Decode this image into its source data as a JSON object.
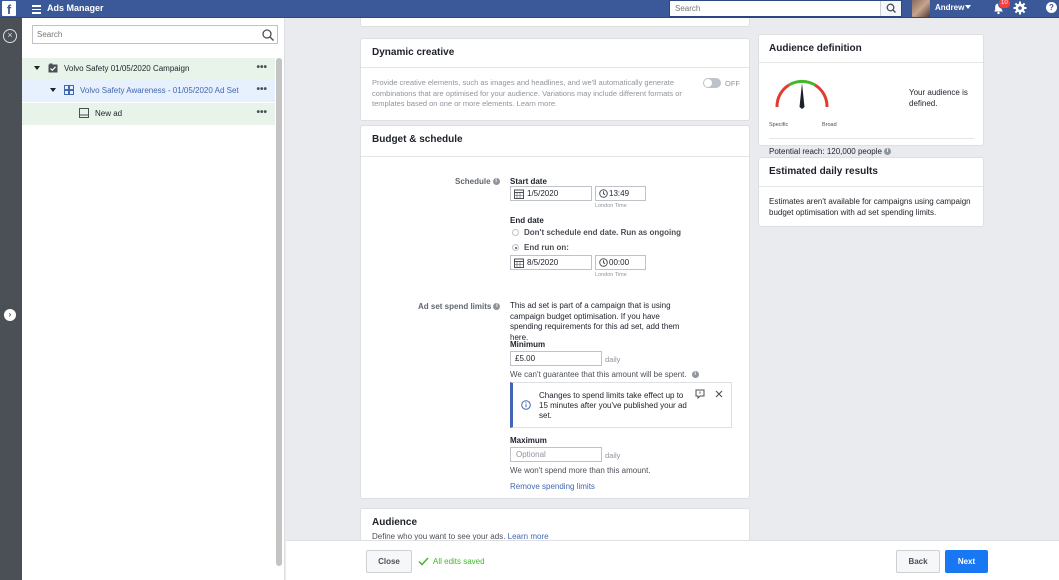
{
  "topbar": {
    "logo": "f",
    "app_title": "Ads Manager",
    "search_placeholder": "Search",
    "user_name": "Andrew",
    "notifications_count": "10",
    "help": "?"
  },
  "left_rail": {
    "close_icon": "close-icon",
    "expand_icon": "chevron-right-icon"
  },
  "tree": {
    "search_placeholder": "Search",
    "items": [
      {
        "label": "Volvo Safety 01/05/2020 Campaign",
        "type": "campaign"
      },
      {
        "label": "Volvo Safety Awareness - 01/05/2020 Ad Set",
        "type": "ad-set"
      },
      {
        "label": "New ad",
        "type": "ad"
      }
    ],
    "more": "•••"
  },
  "dynamic_creative": {
    "title": "Dynamic creative",
    "description": "Provide creative elements, such as images and headlines, and we'll automatically generate combinations that are optimised for your audience. Variations may include different formats or templates based on one or more elements. Learn more.",
    "learn_more": "Learn more",
    "toggle_label": "OFF"
  },
  "budget_schedule": {
    "title": "Budget & schedule",
    "schedule_label": "Schedule",
    "start_date_label": "Start date",
    "start_date": "1/5/2020",
    "start_time": "13:49",
    "timezone_label": "London Time",
    "end_date_label": "End date",
    "end_option_ongoing": "Don't schedule end date. Run as ongoing",
    "end_option_end_on": "End run on:",
    "end_date": "8/5/2020",
    "end_time": "00:00",
    "spend_limits_label": "Ad set spend limits",
    "spend_limits_text": "This ad set is part of a campaign that is using campaign budget optimisation. If you have spending requirements for this ad set, add them here.",
    "minimum_label": "Minimum",
    "minimum_value": "£5.00",
    "daily": "daily",
    "minimum_note": "We can't guarantee that this amount will be spent.",
    "notice_text": "Changes to spend limits take effect up to 15 minutes after you've published your ad set.",
    "maximum_label": "Maximum",
    "maximum_placeholder": "Optional",
    "maximum_note": "We won't spend more than this amount.",
    "remove_link": "Remove spending limits"
  },
  "audience": {
    "title": "Audience",
    "description": "Define who you want to see your ads.",
    "learn_more": "Learn more"
  },
  "audience_definition": {
    "title": "Audience definition",
    "gauge_left": "Specific",
    "gauge_right": "Broad",
    "status_text": "Your audience is defined.",
    "potential_reach": "Potential reach: 120,000 people"
  },
  "estimated_results": {
    "title": "Estimated daily results",
    "text": "Estimates aren't available for campaigns using campaign budget optimisation with ad set spending limits."
  },
  "footer": {
    "close_label": "Close",
    "saved_label": "All edits saved",
    "back_label": "Back",
    "next_label": "Next"
  },
  "colors": {
    "brand": "#3b5998",
    "primary_button": "#1877f2",
    "link": "#4267b2",
    "success": "#42b72a"
  }
}
